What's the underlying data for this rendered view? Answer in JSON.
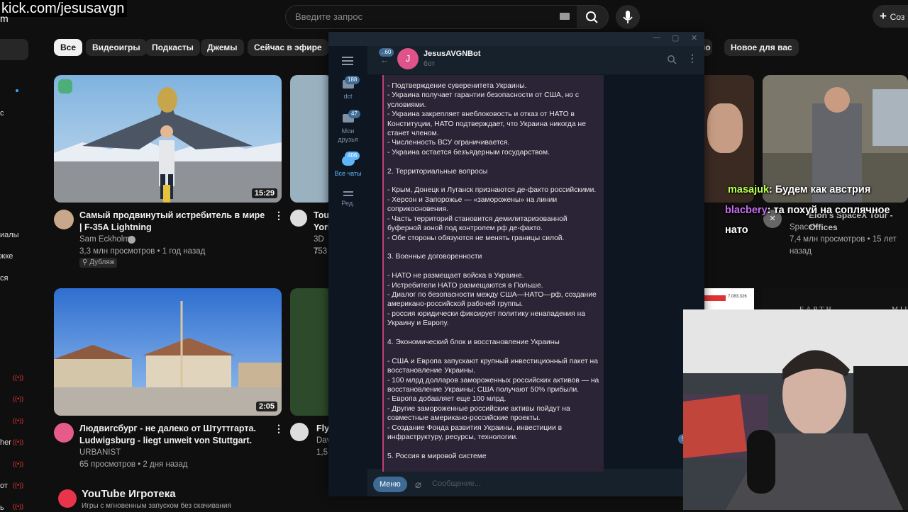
{
  "overlay": {
    "kick_url": "kick.com/jesusavgn",
    "kick_sub": "m"
  },
  "youtube": {
    "search_placeholder": "Введите запрос",
    "create_label": "Соз",
    "chips": [
      "Все",
      "Видеоигры",
      "Подкасты",
      "Джемы",
      "Сейчас в эфире",
      "но",
      "Новое для вас"
    ],
    "sidebar_fragments": [
      "с",
      "иалы",
      "жке",
      "ся",
      "her",
      "от",
      "ь"
    ],
    "videos": [
      {
        "title": "Самый продвинутый истребитель в мире | F-35A Lightning",
        "channel": "Sam Eckholm",
        "meta": "3,3 млн просмотров • 1 год назад",
        "badge": "Дубляж",
        "duration": "15:29"
      },
      {
        "title": "Tou York",
        "channel": "3D T",
        "meta": "753"
      },
      {
        "title": "Elon's SpaceX Tour - Offices",
        "channel": "SpaceX",
        "meta": "7,4 млн просмотров • 15 лет назад"
      },
      {
        "title": "Людвигсбург - не далеко от Штуттгарта. Ludwigsburg - liegt unweit von Stuttgart.",
        "channel": "URBANIST",
        "meta": "65 просмотров • 2 дня назад",
        "duration": "2:05"
      },
      {
        "title": "Flyi",
        "channel": "Dav",
        "meta": "1,5"
      }
    ],
    "shelf": {
      "title": "YouTube Игротека",
      "subtitle": "Игры с мгновенным запуском без скачивания"
    },
    "thumb_texts": {
      "earth": "EARTH",
      "mil": "MIL",
      "number": "7,083,326"
    }
  },
  "telegram": {
    "back_badge": "60",
    "bot_avatar_letter": "J",
    "bot_name": "JesusAVGNBot",
    "bot_status": "бот",
    "folders": [
      {
        "label": "dct",
        "badge": "188"
      },
      {
        "label": "Мои друзья",
        "badge": "47"
      },
      {
        "label": "Все чаты",
        "badge": "406"
      },
      {
        "label": "Ред.",
        "badge": ""
      }
    ],
    "message_lines": [
      "- Подтверждение суверенитета Украины.",
      "- Украина получает гарантии безопасности от США, но с условиями.",
      "- Украина закрепляет внеблоковость и отказ от НАТО в Конституции, НАТО подтверждает, что Украина никогда не станет членом.",
      "- Численность ВСУ ограничивается.",
      "- Украина остается безъядерным государством.",
      "",
      "2. Территориальные вопросы",
      "",
      "- Крым, Донецк и Луганск признаются де-факто российскими.",
      "- Херсон и Запорожье — «заморожены» на линии соприкосновения.",
      "- Часть территорий становится демилитаризованной буферной зоной под контролем рф де-факто.",
      "- Обе стороны обязуются не менять границы силой.",
      "",
      "3. Военные договоренности",
      "",
      "- НАТО не размещает войска в Украине.",
      "- Истребители НАТО размещаются в Польше.",
      "- Диалог по безопасности между США—НАТО—рф, создание американо-российской рабочей группы.",
      "- россия юридически фиксирует политику ненападения на Украину и Европу.",
      "",
      "4. Экономический блок и восстановление Украины",
      "",
      "- США и Европа запускают крупный инвестиционный пакет на восстановление Украины.",
      "- 100 млрд долларов замороженных российских активов — на восстановление Украины; США получают 50% прибыли.",
      "- Европа добавляет еще 100 млрд.",
      "- Другие замороженные российские активы пойдут на совместные американо-российские проекты.",
      "- Создание Фонда развития Украины, инвестиции в инфраструктуру, ресурсы, технологии.",
      "",
      "5. Россия в мировой системе"
    ],
    "menu_label": "Меню",
    "input_placeholder": "Сообщение...",
    "scroll_badge": "9"
  },
  "stream_chat": [
    {
      "user": "masajuk",
      "user_color": "#b6ff4f",
      "text": ": Будем как австрия"
    },
    {
      "user": "blacbery",
      "user_color": "#c86cf0",
      "text": ": та похуй на соплячное нато"
    }
  ]
}
